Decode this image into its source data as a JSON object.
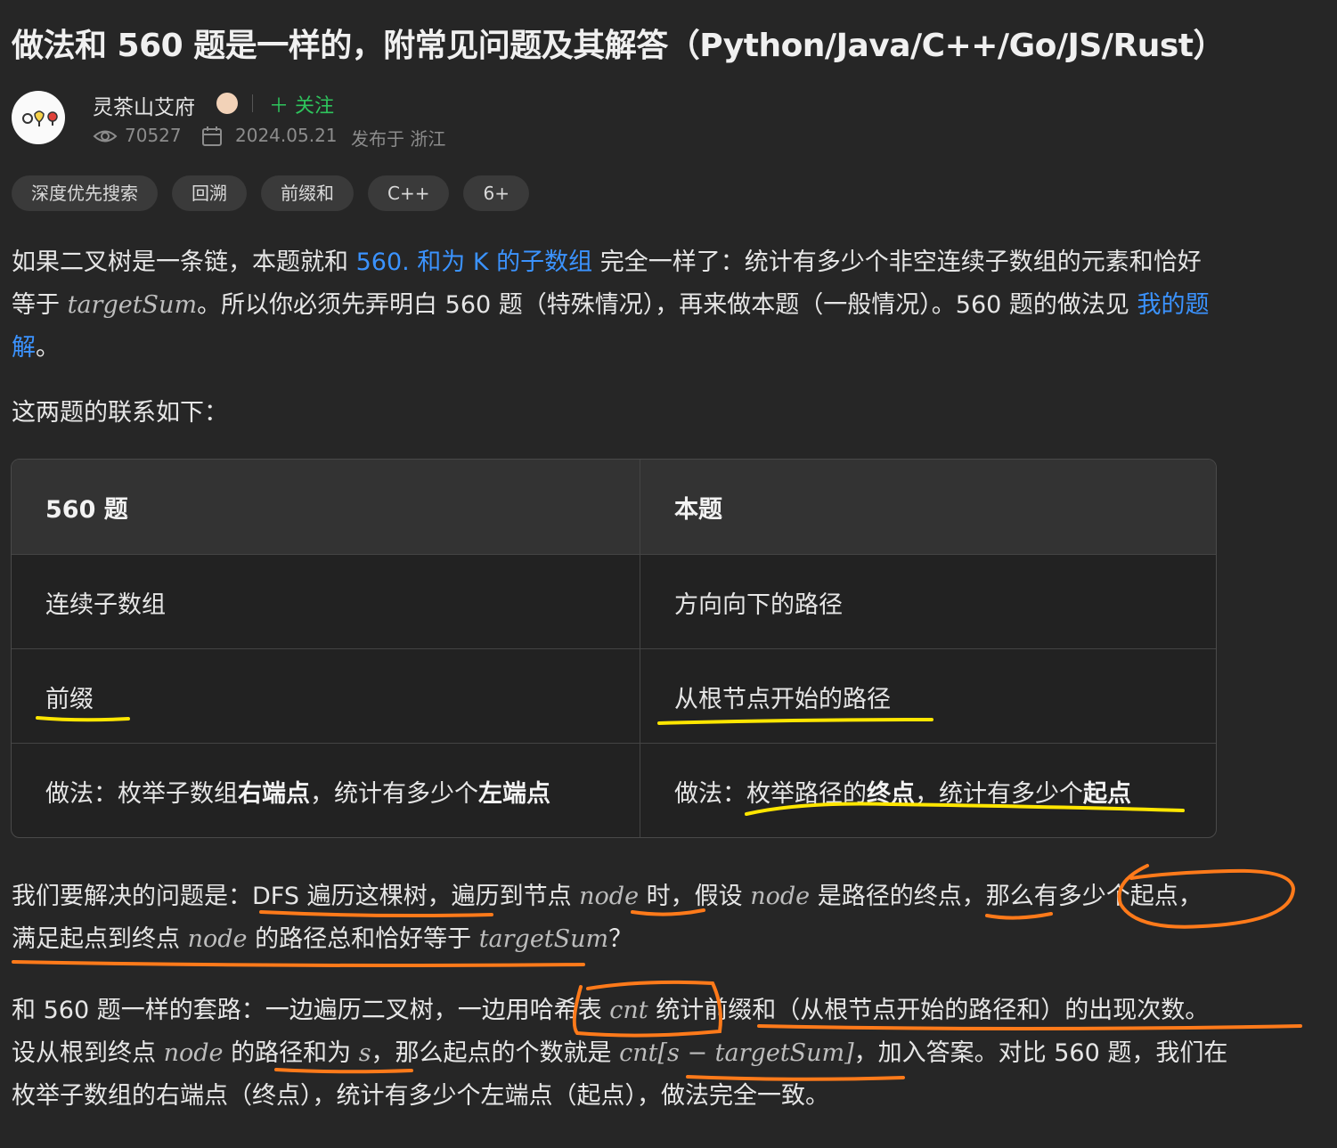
{
  "article": {
    "title": "做法和 560 题是一样的，附常见问题及其解答（Python/Java/C++/Go/JS/Rust）"
  },
  "author": {
    "name": "灵茶山艾府",
    "follow_label": "＋ 关注",
    "views": "70527",
    "date": "2024.05.21",
    "location": "发布于 浙江"
  },
  "tags": [
    "深度优先搜索",
    "回溯",
    "前缀和",
    "C++",
    "6+"
  ],
  "intro": {
    "p1a": "如果二叉树是一条链，本题就和 ",
    "p1_link": "560. 和为 K 的子数组",
    "p1b": " 完全一样了：统计有多少个非空连续子数组的元素和恰好",
    "p2a": "等于 ",
    "p2_math": "targetSum",
    "p2b": "。所以你必须先弄明白 560 题（特殊情况），再来做本题（一般情况）。560 题的做法见 ",
    "p2_link": "我的题",
    "p3_link": "解",
    "p3b": "。",
    "relation": "这两题的联系如下："
  },
  "table": {
    "headers": [
      "560 题",
      "本题"
    ],
    "rows": [
      {
        "left": "连续子数组",
        "right": "方向向下的路径"
      },
      {
        "left": "前缀",
        "right": "从根节点开始的路径"
      }
    ],
    "method": {
      "left_prefix": "做法：枚举子数组",
      "left_bold1": "右端点",
      "left_mid": "，统计有多少个",
      "left_bold2": "左端点",
      "right_prefix": "做法：枚举路径的",
      "right_bold1": "终点",
      "right_mid": "，统计有多少个",
      "right_bold2": "起点"
    }
  },
  "body": {
    "q1a": "我们要解决的问题是：DFS 遍历这棵树，遍历到节点 ",
    "q1_math": "node",
    "q1b": " 时，假设 ",
    "q1_math2": "node",
    "q1c": " 是路径的终点，那么有多少个起点，",
    "q2a": "满足起点到终点 ",
    "q2_math": "node",
    "q2b": " 的路径总和恰好等于 ",
    "q2_math2": "targetSum",
    "q2c": "？",
    "s1a": "和 560 题一样的套路：一边遍历二叉树，一边用哈希表 ",
    "s1_math": "cnt",
    "s1b": " 统计前缀和（从根节点开始的路径和）的出现次数。",
    "s2a": "设从根到终点 ",
    "s2_math": "node",
    "s2b": " 的路径和为 ",
    "s2_math2": "s",
    "s2c": "，那么起点的个数就是 ",
    "s2_math3": "cnt[s − targetSum]",
    "s2d": "，加入答案。对比 560 题，我们在",
    "s3": "枚举子数组的右端点（终点），统计有多少个左端点（起点），做法完全一致。"
  },
  "colors": {
    "background": "#262626",
    "link": "#3b93ff",
    "follow": "#2ec45c",
    "highlight_yellow": "#ffe600",
    "highlight_orange": "#ff7a1a"
  }
}
